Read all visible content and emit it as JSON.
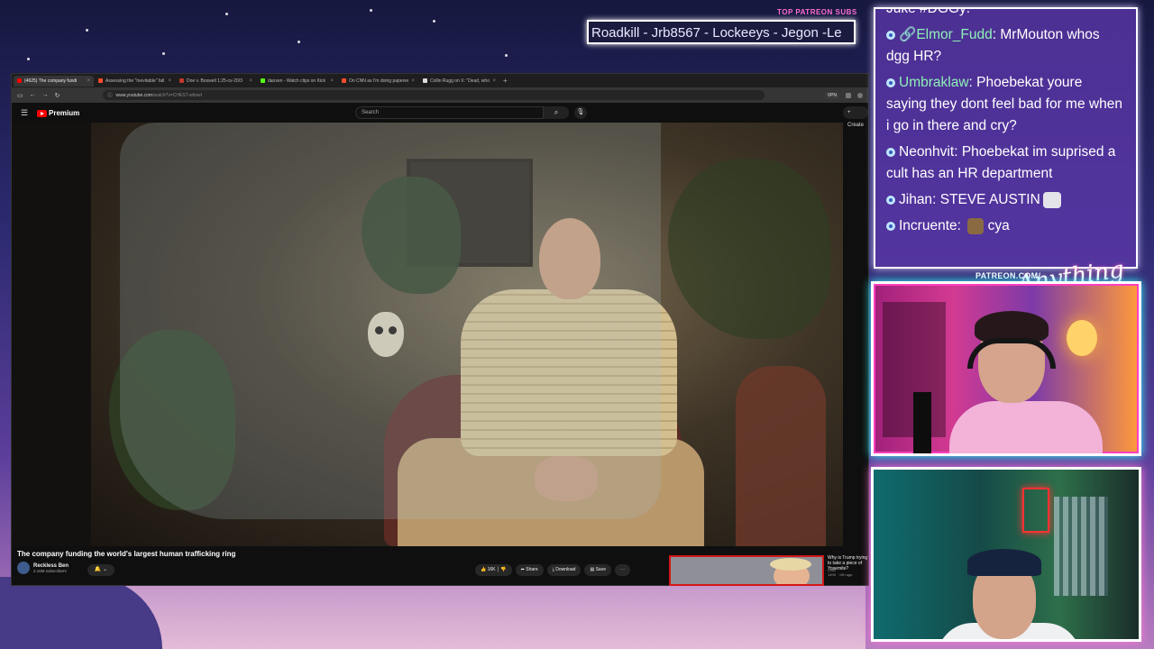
{
  "overlay": {
    "subs_label": "TOP PATREON SUBS",
    "subs_ticker": "Roadkill - Jrb8567 - Lockeeys - Jegon -Le",
    "patreon_tag": "PATREON.COM/",
    "signature": "Anything Else?"
  },
  "browser": {
    "tabs": [
      {
        "title": "(4625) The company fundi",
        "color": "#ff0000",
        "active": true
      },
      {
        "title": "Assessing the \"Inevitable\" fall to",
        "color": "#ff4c2b",
        "active": false
      },
      {
        "title": "Doe v. Boswell 1:25-cv-20/3",
        "color": "#c0392b",
        "active": false
      },
      {
        "title": "dansen - Watch clips on Kick",
        "color": "#53fc18",
        "active": false
      },
      {
        "title": "On CNN as I'm doing paperwork",
        "color": "#ff4c2b",
        "active": false
      },
      {
        "title": "Collin Rugg on X: \"Dead, who",
        "color": "#dddddd",
        "active": false
      }
    ],
    "url_domain": "www.youtube.com",
    "url_path": "/watch?v=CHEST-wbvwI",
    "vpn_label": "VPN"
  },
  "youtube": {
    "brand": "Premium",
    "search_placeholder": "Search",
    "create_label": "+ Create",
    "video_title": "The company funding the world's largest human trafficking ring",
    "channel_name": "Reckless Ben",
    "channel_subs": "2.16M subscribers",
    "likes": "16K",
    "share": "Share",
    "download": "Download",
    "save": "Save",
    "rec_title": "Why is Trump trying to take a piece of Yosemite?",
    "rec_channel": "CNN",
    "rec_meta": "140K · 19h ago"
  },
  "chat": {
    "cut_line": "Juke #DGGy:",
    "messages": [
      {
        "user": "Elmor_Fudd",
        "user_color": "#8ef0b8",
        "text": "MrMouton whos dgg HR?",
        "prefix": "🔗"
      },
      {
        "user": "Umbraklaw",
        "user_color": "#8ef0b8",
        "text": "Phoebekat youre saying they dont feel bad for me when i go in there and cry?",
        "prefix": ""
      },
      {
        "user": "Neonhvit",
        "user_color": "#ffffff",
        "text": "Phoebekat im suprised a cult has an HR department",
        "prefix": ""
      },
      {
        "user": "Jihan",
        "user_color": "#ffffff",
        "text": "STEVE AUSTIN",
        "prefix": "",
        "emote": "light"
      },
      {
        "user": "Incruente",
        "user_color": "#ffffff",
        "text": "cya",
        "prefix": "",
        "emote_before": "brown"
      }
    ]
  },
  "colors": {
    "chat_bg": "#5c37aa",
    "accent_pink": "#ff6fd2",
    "yt_red": "#ff0000"
  }
}
